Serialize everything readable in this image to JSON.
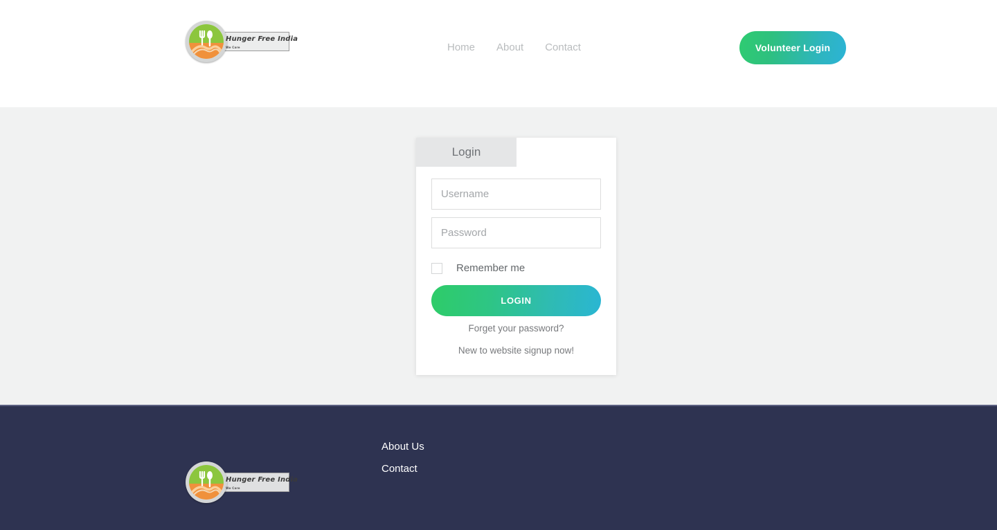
{
  "header": {
    "logo": {
      "icon_name": "hunger-free-india-logo",
      "banner_text": "Hunger Free India",
      "banner_subtext": "We Care"
    },
    "nav": [
      {
        "label": "Home"
      },
      {
        "label": "About"
      },
      {
        "label": "Contact"
      }
    ],
    "volunteer_button": {
      "label": "Volunteer Login",
      "gradient_from": "#2ecc71",
      "gradient_to": "#2cb4d6"
    }
  },
  "login_card": {
    "tab_label": "Login",
    "username": {
      "value": "",
      "placeholder": "Username"
    },
    "password": {
      "value": "",
      "placeholder": "Password"
    },
    "remember": {
      "label": "Remember me",
      "checked": false
    },
    "submit_label": "LOGIN",
    "forgot_link": "Forget your password?",
    "signup_link": "New to website signup now!"
  },
  "footer": {
    "logo": {
      "icon_name": "hunger-free-india-logo",
      "banner_text": "Hunger Free India",
      "banner_subtext": "We Care"
    },
    "links": [
      {
        "label": "About Us"
      },
      {
        "label": "Contact"
      }
    ],
    "background_color": "#2e3351"
  },
  "theme": {
    "page_background": "#f1f2f2",
    "header_background": "#ffffff",
    "accent_green": "#2ecc71",
    "accent_blue": "#2cb4d6",
    "footer_navy": "#2e3351"
  }
}
